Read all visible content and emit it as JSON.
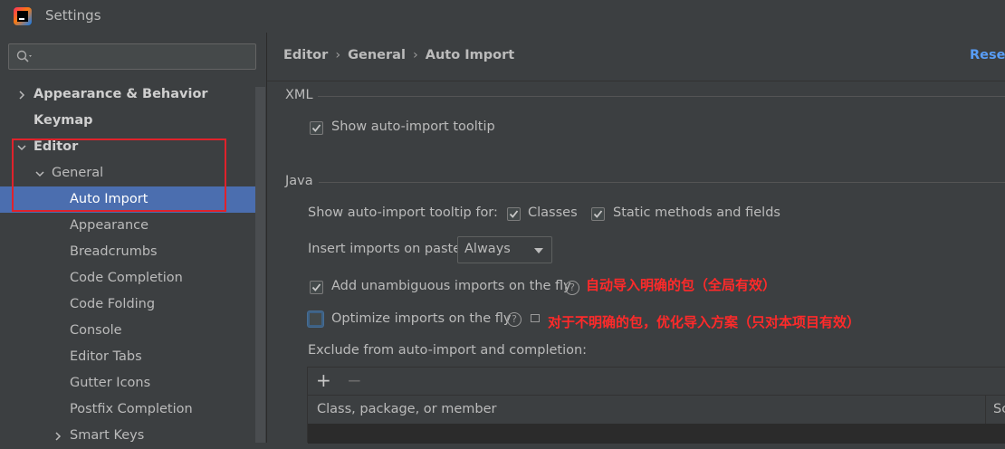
{
  "window": {
    "title": "Settings"
  },
  "search": {
    "placeholder": ""
  },
  "tree": [
    {
      "label": "Appearance & Behavior",
      "bold": true,
      "arrow": "right"
    },
    {
      "label": "Keymap",
      "bold": true,
      "arrow": ""
    },
    {
      "label": "Editor",
      "bold": true,
      "arrow": "down"
    },
    {
      "label": "General",
      "bold": false,
      "arrow": "down"
    },
    {
      "label": "Auto Import",
      "bold": false,
      "arrow": "",
      "selected": true
    },
    {
      "label": "Appearance",
      "bold": false,
      "arrow": ""
    },
    {
      "label": "Breadcrumbs",
      "bold": false,
      "arrow": ""
    },
    {
      "label": "Code Completion",
      "bold": false,
      "arrow": ""
    },
    {
      "label": "Code Folding",
      "bold": false,
      "arrow": ""
    },
    {
      "label": "Console",
      "bold": false,
      "arrow": ""
    },
    {
      "label": "Editor Tabs",
      "bold": false,
      "arrow": ""
    },
    {
      "label": "Gutter Icons",
      "bold": false,
      "arrow": ""
    },
    {
      "label": "Postfix Completion",
      "bold": false,
      "arrow": ""
    },
    {
      "label": "Smart Keys",
      "bold": false,
      "arrow": "right"
    }
  ],
  "breadcrumb": [
    "Editor",
    "General",
    "Auto Import"
  ],
  "reset_label": "Reset",
  "xml": {
    "title": "XML",
    "show_tooltip": {
      "label": "Show auto-import tooltip",
      "checked": true
    }
  },
  "java": {
    "title": "Java",
    "tooltip_for_label": "Show auto-import tooltip for:",
    "classes": {
      "label": "Classes",
      "checked": true
    },
    "static_methods": {
      "label": "Static methods and fields",
      "checked": true
    },
    "insert_on_paste_label": "Insert imports on paste:",
    "insert_on_paste_value": "Always",
    "add_unambiguous": {
      "label": "Add unambiguous imports on the fly",
      "checked": true,
      "note": "自动导入明确的包（全局有效）"
    },
    "optimize_imports": {
      "label": "Optimize imports on the fly",
      "checked": false,
      "note": "对于不明确的包，优化导入方案（只对本项目有效）"
    },
    "exclude_label": "Exclude from auto-import and completion:",
    "table": {
      "add": "+",
      "remove": "−",
      "columns": [
        "Class, package, or member",
        "Sc"
      ]
    }
  },
  "colors": {
    "selection": "#4b6eaf",
    "annotation": "#ff2a2a",
    "link": "#589df6",
    "highlight_box": "#e0222b"
  }
}
